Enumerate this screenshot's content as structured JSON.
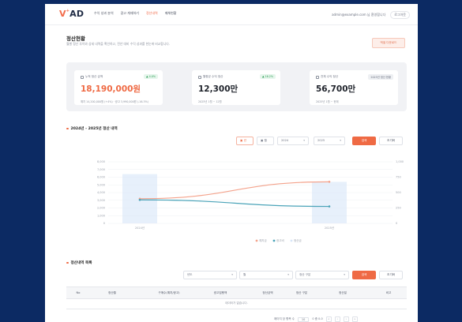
{
  "header": {
    "logo": "VAD",
    "nav": [
      "수익 성과 분석",
      "광고 게재하기",
      "정산내역",
      "매체현황"
    ],
    "active_index": 2,
    "user_email": "admin@example.com 님 환영합니다",
    "logout_label": "로그아웃"
  },
  "page": {
    "title": "정산현황",
    "subtitle": "월별 정산 추이와 상세 내역을 확인하고, 전년 대비 수익 성과를 한눈에 비교합니다.",
    "export_label": "엑셀 다운로드"
  },
  "kpis": [
    {
      "label": "누적 정산 금액",
      "badge": "▲ 4.0%",
      "badge_type": "up",
      "value": "18,190,000원",
      "value_color": "orange",
      "meta": "예치 14,200,000원 (+4%) · 광고 3,990,000원 (-16.3%)"
    },
    {
      "label": "월평균 수익 정산",
      "badge": "▲ 16.2%",
      "badge_type": "up",
      "value": "12,300만",
      "value_color": "dark",
      "meta": "2025년 1월 ~ 12월"
    },
    {
      "label": "전체 수익 정산",
      "badge": "2025년 정산 현황",
      "badge_type": "gray",
      "value": "56,700만",
      "value_color": "dark",
      "meta": "2025년 1월 ~ 현재"
    }
  ],
  "chart_section": {
    "title": "2024년 - 2025년 정산 내역",
    "filters": {
      "period_label": "년",
      "monthly_label": "월",
      "start_year": "2024",
      "end_year": "2025",
      "search_label": "검색",
      "reset_label": "초기화"
    }
  },
  "chart_data": {
    "type": "line",
    "categories": [
      "2024년",
      "2025년"
    ],
    "series": [
      {
        "name": "예치금",
        "color": "#f4a38c",
        "values": [
          3200,
          5400
        ],
        "axis": "left"
      },
      {
        "name": "광고비",
        "color": "#4aa3b8",
        "values": [
          3050,
          2200
        ],
        "axis": "left"
      },
      {
        "name": "정산금",
        "color": "#d7e6f8",
        "values": [
          6400,
          5400
        ],
        "axis": "left",
        "render": "bar"
      }
    ],
    "ylim_left": [
      0,
      8000
    ],
    "yticks_left": [
      0,
      1000,
      2000,
      3000,
      4000,
      5000,
      6000,
      7000,
      8000
    ],
    "ylim_right": [
      0,
      1000
    ],
    "yticks_right": [
      0,
      250,
      500,
      750,
      1000
    ],
    "xlabel": "",
    "ylabel_left": "",
    "ylabel_right": "",
    "legend_position": "bottom"
  },
  "list_section": {
    "title": "정산내역 목록",
    "filters": {
      "year_placeholder": "년도",
      "month_placeholder": "월",
      "type_placeholder": "정산 구분",
      "search_label": "검색",
      "reset_label": "초기화"
    }
  },
  "table": {
    "columns": [
      "No",
      "정산월",
      "구매수(예치/광고)",
      "광고집행액",
      "정산금액",
      "정산 구분",
      "정산일",
      "비고"
    ],
    "empty_text": "데이터가 없습니다."
  },
  "pagination": {
    "page_size_label": "페이지 당 항목 수",
    "page_size": "10",
    "range_text": "0 중 0-0"
  }
}
